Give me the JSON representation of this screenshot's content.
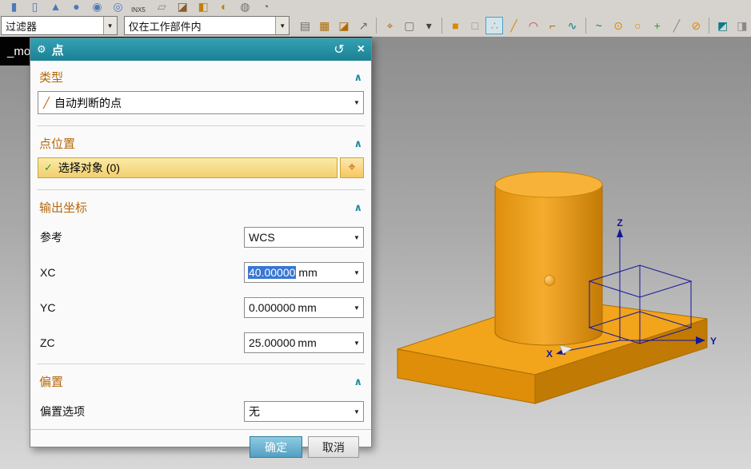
{
  "colors": {
    "accent_teal": "#1f8ea1",
    "section_orange": "#b4690e",
    "selection_yellow": "#f1cf70",
    "value_highlight_blue": "#3877d3",
    "model_orange": "#f2a41b",
    "wcs_blue": "#15159b"
  },
  "window": {
    "part_tab": "_mo"
  },
  "toolbar": {
    "row1_label": "INX5",
    "row1_icons": [
      {
        "name": "block-primitive-icon",
        "glyph": "▮",
        "color": "#4d79ba"
      },
      {
        "name": "cylinder-primitive-icon",
        "glyph": "▯",
        "color": "#4d79ba"
      },
      {
        "name": "cone-primitive-icon",
        "glyph": "▲",
        "color": "#4d79ba"
      },
      {
        "name": "sphere-primitive-icon",
        "glyph": "●",
        "color": "#4d79ba"
      },
      {
        "name": "unite-icon",
        "glyph": "◉",
        "color": "#4d79ba"
      },
      {
        "name": "subtract-icon",
        "glyph": "◎",
        "color": "#4d79ba"
      },
      {
        "name": "datum-plane-icon",
        "glyph": "▱",
        "color": "#6f9660"
      },
      {
        "name": "sketch-icon",
        "glyph": "◪",
        "color": "#8a5a2a"
      },
      {
        "name": "extrude-icon",
        "glyph": "◧",
        "color": "#c07f10"
      },
      {
        "name": "revolve-icon",
        "glyph": "◐",
        "color": "#c07f10"
      },
      {
        "name": "hole-icon",
        "glyph": "◍",
        "color": "#707070"
      },
      {
        "name": "edge-blend-icon",
        "glyph": "◔",
        "color": "#707070"
      }
    ],
    "filter_dropdown": "过滤器",
    "scope_dropdown": "仅在工作部件内",
    "row2_icons": [
      {
        "name": "paste-icon",
        "glyph": "▤",
        "color": "#6b6b6b"
      },
      {
        "name": "snap-grid-icon",
        "glyph": "▦",
        "color": "#b06a00"
      },
      {
        "name": "sketch-edit-icon",
        "glyph": "◪",
        "color": "#b06a00"
      },
      {
        "name": "move-object-icon",
        "glyph": "↗",
        "color": "#6b6b6b"
      },
      {
        "name": "snap-point-icon",
        "glyph": "⌖",
        "color": "#b06a00"
      },
      {
        "name": "select-rectangle-icon",
        "glyph": "▢",
        "color": "#6b6b6b"
      },
      {
        "name": "more-options-arrow",
        "glyph": "▾",
        "color": "#444444"
      },
      {
        "name": "solid-cube-icon",
        "glyph": "■",
        "color": "#d98a00"
      },
      {
        "name": "shaded-cube-icon",
        "glyph": "□",
        "color": "#8a8a8a"
      },
      {
        "name": "point-tool-icon",
        "glyph": "∴",
        "color": "#d98a00"
      },
      {
        "name": "line-tool-icon",
        "glyph": "╱",
        "color": "#d98a00"
      },
      {
        "name": "arc-tool-icon",
        "glyph": "◠",
        "color": "#b23b3b"
      },
      {
        "name": "profile-tool-icon",
        "glyph": "⌐",
        "color": "#b06a00"
      },
      {
        "name": "spline-tool-icon",
        "glyph": "∿",
        "color": "#0b7a8a"
      },
      {
        "name": "studio-spline-icon",
        "glyph": "~",
        "color": "#0b7a8a"
      },
      {
        "name": "circle-center-icon",
        "glyph": "⊙",
        "color": "#d98a00"
      },
      {
        "name": "circle-tool-icon",
        "glyph": "○",
        "color": "#d98a00"
      },
      {
        "name": "plus-tool-icon",
        "glyph": "+",
        "color": "#2f9e2f"
      },
      {
        "name": "slash-tool-icon",
        "glyph": "╱",
        "color": "#8a8a8a"
      },
      {
        "name": "target-point-icon",
        "glyph": "⊘",
        "color": "#d98a00"
      },
      {
        "name": "datum-csys-icon",
        "glyph": "◩",
        "color": "#0b7a8a"
      },
      {
        "name": "view-cube-icon",
        "glyph": "◨",
        "color": "#8a8a8a"
      }
    ]
  },
  "dialog": {
    "title": "点",
    "icons": {
      "gear": "⚙",
      "reset": "↺",
      "close": "×",
      "chevron": "∧",
      "check": "✓",
      "target": "⌖",
      "arrow": "▼",
      "type_icon": "╱"
    },
    "type": {
      "header": "类型",
      "value": "自动判断的点"
    },
    "location": {
      "header": "点位置",
      "select_label": "选择对象 (0)"
    },
    "coords": {
      "header": "输出坐标",
      "ref_label": "参考",
      "ref_value": "WCS",
      "rows": [
        {
          "label": "XC",
          "value": "40.00000",
          "unit": "mm"
        },
        {
          "label": "YC",
          "value": "0.000000",
          "unit": "mm"
        },
        {
          "label": "ZC",
          "value": "25.00000",
          "unit": "mm"
        }
      ]
    },
    "offset": {
      "header": "偏置",
      "option_label": "偏置选项",
      "option_value": "无"
    },
    "buttons": {
      "ok": "确定",
      "cancel": "取消"
    }
  },
  "viewport": {
    "axes": {
      "x": "X",
      "y": "Y",
      "z": "Z"
    }
  }
}
